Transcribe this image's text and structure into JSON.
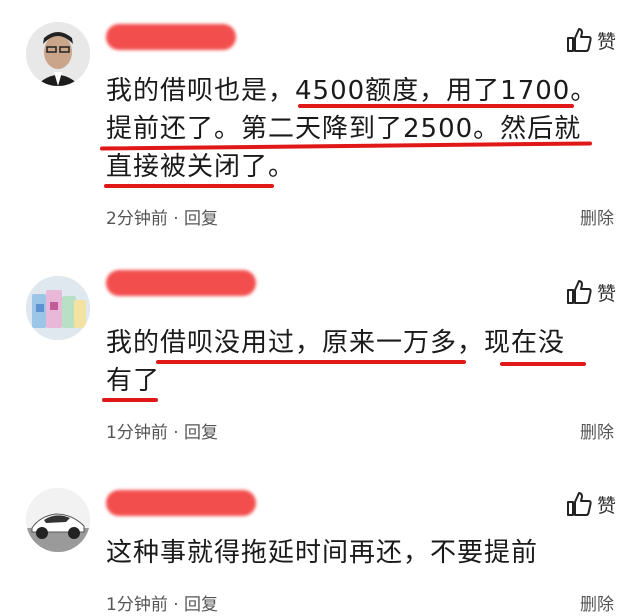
{
  "comments": [
    {
      "text_lines": [
        "我的借呗也是，4500额度，用了1700。",
        "提前还了。第二天降到了2500。然后就",
        "直接被关闭了。"
      ],
      "time": "2分钟前",
      "reply": "回复",
      "like": "赞",
      "delete": "删除"
    },
    {
      "text_lines": [
        "我的借呗没用过，原来一万多，现在没",
        "有了"
      ],
      "time": "1分钟前",
      "reply": "回复",
      "like": "赞",
      "delete": "删除"
    },
    {
      "text_lines": [
        "这种事就得拖延时间再还，不要提前"
      ],
      "time": "1分钟前",
      "reply": "回复",
      "like": "赞",
      "delete": "删除"
    }
  ],
  "meta_separator": " · ",
  "colors": {
    "redaction": "#f23b3b",
    "underline": "#e01818"
  }
}
